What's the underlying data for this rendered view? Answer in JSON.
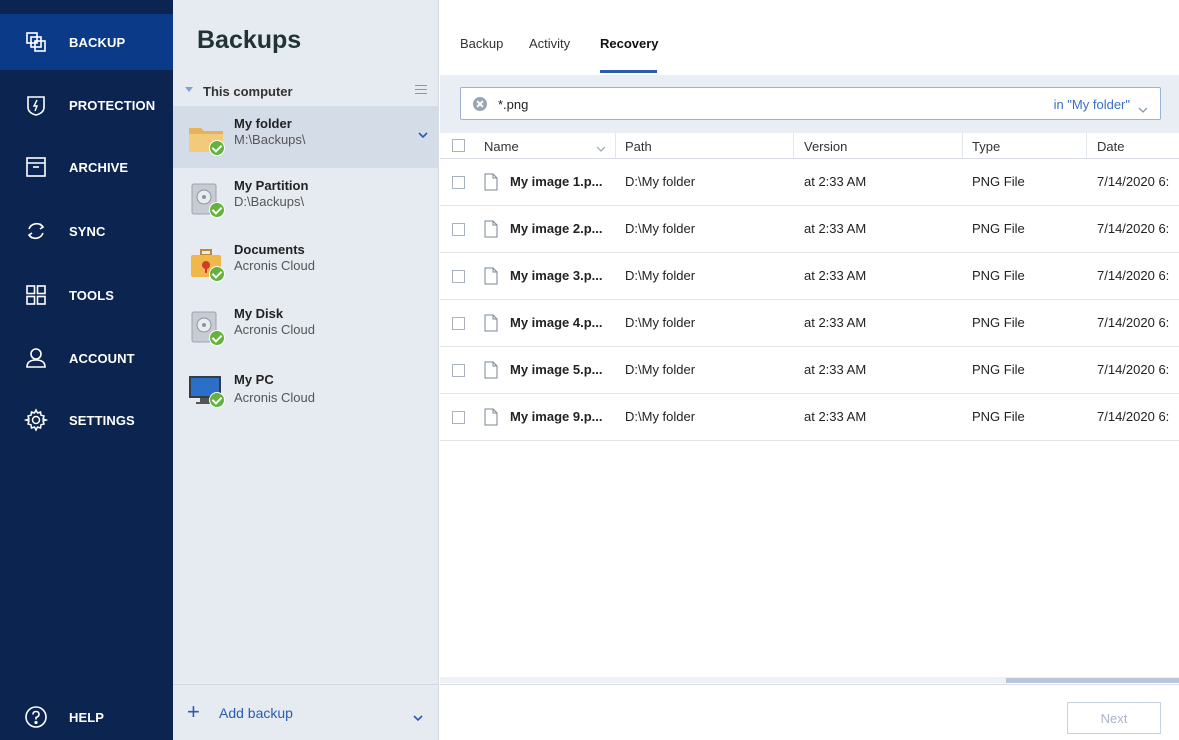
{
  "nav": {
    "items": [
      {
        "label": "BACKUP",
        "icon": "backup-icon"
      },
      {
        "label": "PROTECTION",
        "icon": "shield-icon"
      },
      {
        "label": "ARCHIVE",
        "icon": "archive-icon"
      },
      {
        "label": "SYNC",
        "icon": "sync-icon"
      },
      {
        "label": "TOOLS",
        "icon": "tools-icon"
      },
      {
        "label": "ACCOUNT",
        "icon": "account-icon"
      },
      {
        "label": "SETTINGS",
        "icon": "gear-icon"
      }
    ],
    "help": {
      "label": "HELP",
      "icon": "help-icon"
    }
  },
  "backups": {
    "title": "Backups",
    "group": "This computer",
    "items": [
      {
        "name": "My folder",
        "location": "M:\\Backups\\",
        "icon": "folder-icon"
      },
      {
        "name": "My Partition",
        "location": "D:\\Backups\\",
        "icon": "drive-icon"
      },
      {
        "name": "Documents",
        "location": "Acronis Cloud",
        "icon": "briefcase-icon"
      },
      {
        "name": "My Disk",
        "location": "Acronis Cloud",
        "icon": "drive-icon"
      },
      {
        "name": "My PC",
        "location": "Acronis Cloud",
        "icon": "monitor-icon"
      }
    ],
    "add_label": "Add backup"
  },
  "tabs": [
    "Backup",
    "Activity",
    "Recovery"
  ],
  "search": {
    "value": "*.png",
    "scope": "in \"My folder\""
  },
  "table": {
    "headers": [
      "Name",
      "Path",
      "Version",
      "Type",
      "Date"
    ],
    "rows": [
      {
        "name": "My image 1.p...",
        "path": "D:\\My folder",
        "version": "at 2:33 AM",
        "type": "PNG File",
        "date": "7/14/2020 6:"
      },
      {
        "name": "My image 2.p...",
        "path": "D:\\My folder",
        "version": "at 2:33 AM",
        "type": "PNG File",
        "date": "7/14/2020 6:"
      },
      {
        "name": "My image 3.p...",
        "path": "D:\\My folder",
        "version": "at 2:33 AM",
        "type": "PNG File",
        "date": "7/14/2020 6:"
      },
      {
        "name": "My image 4.p...",
        "path": "D:\\My folder",
        "version": "at 2:33 AM",
        "type": "PNG File",
        "date": "7/14/2020 6:"
      },
      {
        "name": "My image 5.p...",
        "path": "D:\\My folder",
        "version": "at 2:33 AM",
        "type": "PNG File",
        "date": "7/14/2020 6:"
      },
      {
        "name": "My image 9.p...",
        "path": "D:\\My folder",
        "version": "at 2:33 AM",
        "type": "PNG File",
        "date": "7/14/2020 6:"
      }
    ]
  },
  "footer": {
    "next_label": "Next"
  },
  "colors": {
    "nav_bg": "#0c2550",
    "nav_active": "#0a3a88",
    "accent": "#2a5bb0",
    "check": "#61b33b"
  }
}
